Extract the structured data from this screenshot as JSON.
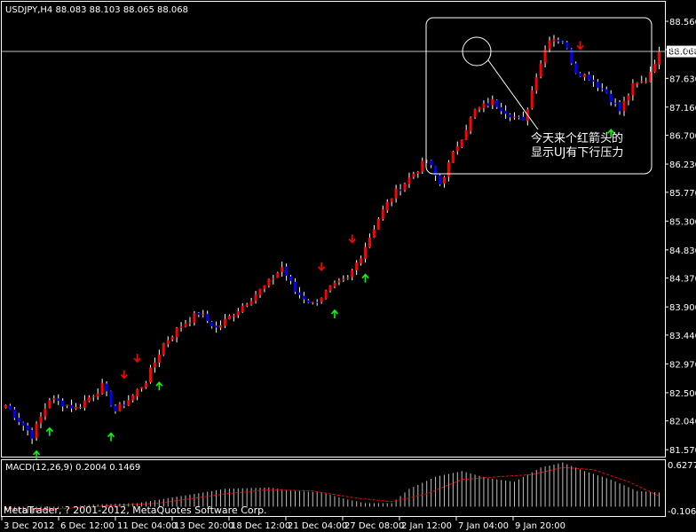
{
  "window": {
    "symbol_info": "USDJPY,H4  88.083 88.103 88.065 88.068",
    "copyright": "MetaTrader, ? 2001-2012, MetaQuotes Software Corp."
  },
  "colors": {
    "background": "#000000",
    "bull": "#ff0000",
    "bear": "#0000ff",
    "wick": "#ffffff",
    "arrow_up": "#00ff00",
    "arrow_down": "#ff0000",
    "macd_hist": "#c0c0c0",
    "macd_signal": "#ff0000",
    "axis_text": "#ffffff"
  },
  "annotation": {
    "line1": "今天来个红箭头的",
    "line2": "显示UJ有下行压力"
  },
  "macd": {
    "label": "MACD(12,26,9) 0.2004 0.1469",
    "top_label": "0.6277",
    "bottom_label": "-0.1064"
  },
  "chart_data": {
    "type": "candlestick",
    "title": "USDJPY,H4",
    "ohlc_header": {
      "open": 88.083,
      "high": 88.103,
      "low": 88.065,
      "close": 88.068
    },
    "current_price": 88.068,
    "ylim": [
      81.5,
      88.85
    ],
    "y_ticks": [
      "88.560",
      "88.100",
      "87.630",
      "87.160",
      "86.700",
      "86.230",
      "85.770",
      "85.300",
      "84.830",
      "84.370",
      "83.900",
      "83.440",
      "82.970",
      "82.500",
      "82.040",
      "81.570"
    ],
    "y_tick_values": [
      88.56,
      88.1,
      87.63,
      87.16,
      86.7,
      86.23,
      85.77,
      85.3,
      84.83,
      84.37,
      83.9,
      83.44,
      82.97,
      82.5,
      82.04,
      81.57
    ],
    "x_ticks": [
      "3 Dec 2012",
      "6 Dec 12:00",
      "11 Dec 04:00",
      "13 Dec 20:00",
      "18 Dec 12:00",
      "21 Dec 04:00",
      "27 Dec 08:00",
      "2 Jan 12:00",
      "7 Jan 04:00",
      "9 Jan 20:00"
    ],
    "close_path": [
      [
        0,
        82.3
      ],
      [
        6,
        81.8
      ],
      [
        10,
        82.4
      ],
      [
        16,
        82.25
      ],
      [
        22,
        82.6
      ],
      [
        25,
        82.2
      ],
      [
        29,
        82.45
      ],
      [
        32,
        82.7
      ],
      [
        36,
        83.3
      ],
      [
        40,
        83.6
      ],
      [
        44,
        83.8
      ],
      [
        48,
        83.55
      ],
      [
        52,
        83.8
      ],
      [
        56,
        84.05
      ],
      [
        60,
        84.3
      ],
      [
        63,
        84.55
      ],
      [
        66,
        84.15
      ],
      [
        70,
        83.95
      ],
      [
        74,
        84.2
      ],
      [
        78,
        84.35
      ],
      [
        81,
        84.75
      ],
      [
        85,
        85.35
      ],
      [
        88,
        85.7
      ],
      [
        92,
        86.0
      ],
      [
        96,
        86.3
      ],
      [
        99,
        85.9
      ],
      [
        103,
        86.55
      ],
      [
        107,
        87.1
      ],
      [
        111,
        87.25
      ],
      [
        116,
        87.0
      ],
      [
        118,
        86.9
      ],
      [
        121,
        87.7
      ],
      [
        124,
        88.3
      ],
      [
        127,
        88.25
      ],
      [
        130,
        87.75
      ],
      [
        133,
        87.65
      ],
      [
        137,
        87.4
      ],
      [
        140,
        87.1
      ],
      [
        143,
        87.5
      ],
      [
        146,
        87.6
      ],
      [
        149,
        88.07
      ]
    ],
    "signal_arrows": [
      {
        "bar": 7,
        "dir": "up"
      },
      {
        "bar": 10,
        "dir": "up"
      },
      {
        "bar": 24,
        "dir": "up"
      },
      {
        "bar": 27,
        "dir": "down"
      },
      {
        "bar": 30,
        "dir": "down"
      },
      {
        "bar": 35,
        "dir": "up"
      },
      {
        "bar": 72,
        "dir": "down"
      },
      {
        "bar": 75,
        "dir": "up"
      },
      {
        "bar": 79,
        "dir": "down"
      },
      {
        "bar": 82,
        "dir": "up"
      },
      {
        "bar": 131,
        "dir": "down"
      },
      {
        "bar": 138,
        "dir": "up"
      }
    ],
    "macd_hist_path": [
      [
        0,
        -0.05
      ],
      [
        6,
        -0.1
      ],
      [
        12,
        -0.02
      ],
      [
        20,
        0.03
      ],
      [
        30,
        0.05
      ],
      [
        40,
        0.15
      ],
      [
        50,
        0.25
      ],
      [
        60,
        0.27
      ],
      [
        66,
        0.22
      ],
      [
        72,
        0.2
      ],
      [
        78,
        0.1
      ],
      [
        82,
        0.05
      ],
      [
        88,
        0.05
      ],
      [
        92,
        0.25
      ],
      [
        98,
        0.42
      ],
      [
        104,
        0.5
      ],
      [
        110,
        0.4
      ],
      [
        116,
        0.35
      ],
      [
        122,
        0.55
      ],
      [
        127,
        0.62
      ],
      [
        132,
        0.5
      ],
      [
        138,
        0.38
      ],
      [
        144,
        0.22
      ],
      [
        149,
        0.2
      ]
    ],
    "macd_signal_path": [
      [
        0,
        -0.02
      ],
      [
        10,
        -0.04
      ],
      [
        20,
        0.0
      ],
      [
        35,
        0.05
      ],
      [
        50,
        0.18
      ],
      [
        60,
        0.24
      ],
      [
        70,
        0.22
      ],
      [
        80,
        0.12
      ],
      [
        88,
        0.07
      ],
      [
        96,
        0.18
      ],
      [
        104,
        0.38
      ],
      [
        112,
        0.42
      ],
      [
        120,
        0.45
      ],
      [
        127,
        0.55
      ],
      [
        134,
        0.52
      ],
      [
        142,
        0.35
      ],
      [
        149,
        0.15
      ]
    ]
  }
}
